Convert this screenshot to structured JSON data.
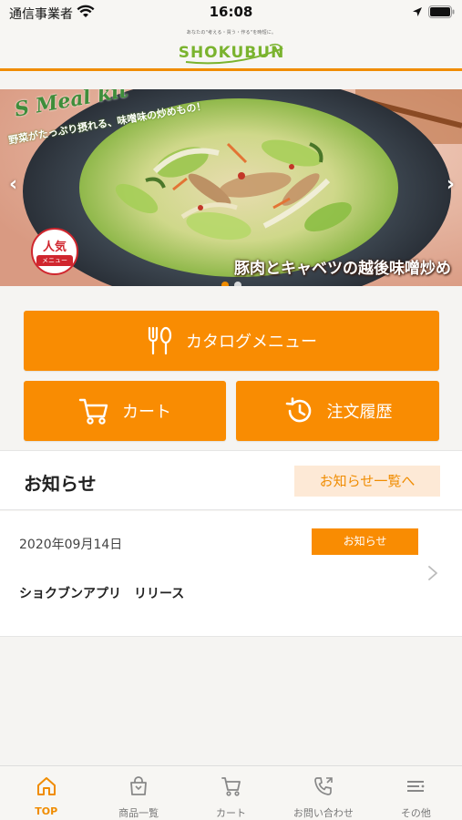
{
  "status_bar": {
    "carrier": "通信事業者",
    "time": "16:08"
  },
  "header": {
    "logo_text": "SHOKUBUN",
    "logo_tagline": "あなたの\"考える・買う・作る\"を時短に。"
  },
  "banner": {
    "meal_kit_label": "S Meal kit",
    "subtitle": "野菜がたっぷり摂れる、味噌味の炒めもの！",
    "title": "豚肉とキャベツの越後味噌炒め",
    "badge_top": "人気",
    "badge_bottom": "メニュー",
    "prev_arrow": "‹",
    "next_arrow": "›",
    "slide_count": 2,
    "active_slide": 0
  },
  "actions": {
    "catalog_label": "カタログメニュー",
    "cart_label": "カート",
    "history_label": "注文履歴"
  },
  "notices": {
    "section_title": "お知らせ",
    "view_all_label": "お知らせ一覧へ",
    "items": [
      {
        "date": "2020年09月14日",
        "category": "お知らせ",
        "text": "ショクブンアプリ　リリース"
      }
    ]
  },
  "tab_bar": {
    "items": [
      {
        "label": "TOP",
        "icon": "home-icon",
        "active": true
      },
      {
        "label": "商品一覧",
        "icon": "bag-icon",
        "active": false
      },
      {
        "label": "カート",
        "icon": "cart-icon",
        "active": false
      },
      {
        "label": "お問い合わせ",
        "icon": "phone-icon",
        "active": false
      },
      {
        "label": "その他",
        "icon": "menu-icon",
        "active": false
      }
    ]
  },
  "colors": {
    "accent": "#f98c02",
    "accent_light": "#fde9d6",
    "logo_green": "#7ab32e",
    "background": "#f5f4f2"
  }
}
